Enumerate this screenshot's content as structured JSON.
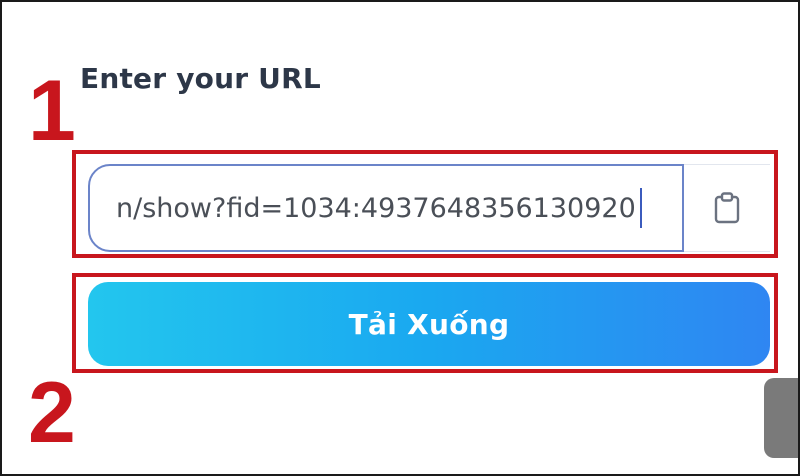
{
  "form": {
    "url_label": "Enter your URL",
    "url_value": "n/show?fid=1034:4937648356130920",
    "download_label": "Tải Xuống"
  },
  "annotations": {
    "step_1": "1",
    "step_2": "2"
  },
  "icons": {
    "paste": "clipboard-icon"
  },
  "colors": {
    "annotation_red": "#c8161d",
    "button_gradient_start": "#23c6ee",
    "button_gradient_end": "#2f86f2",
    "label_text": "#2d3748"
  }
}
